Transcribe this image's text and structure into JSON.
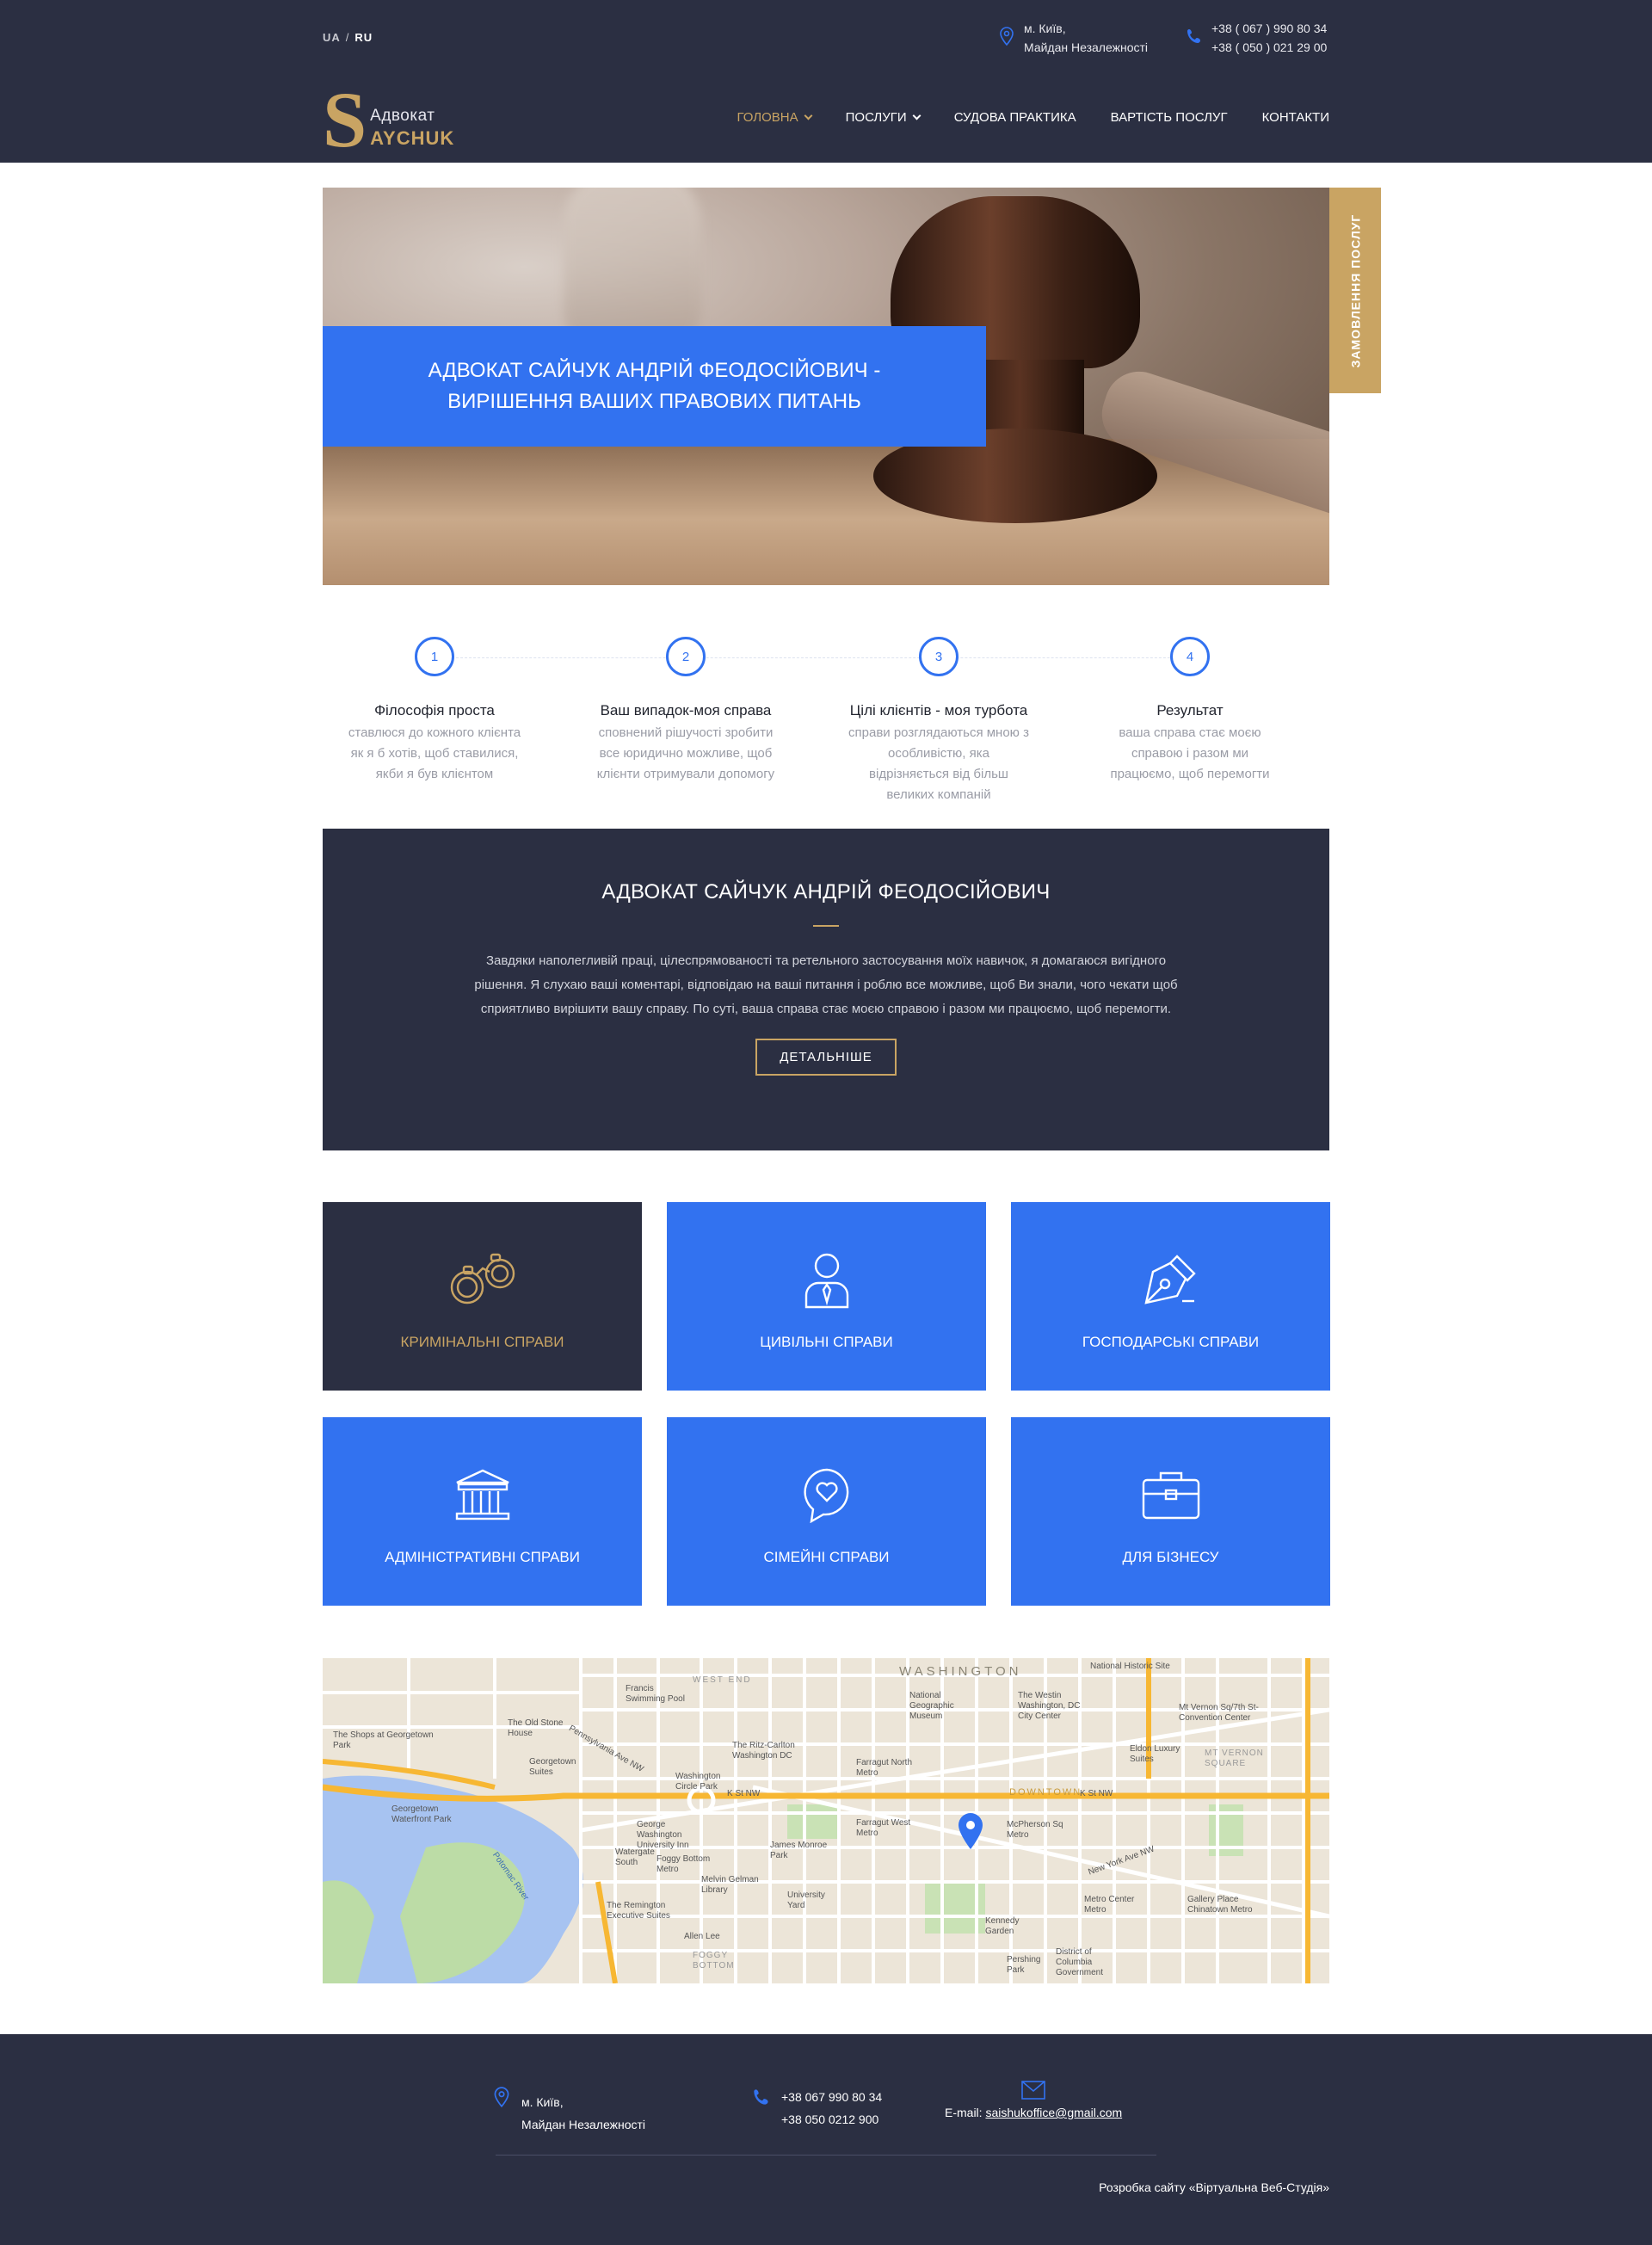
{
  "header": {
    "lang": {
      "ua": "UA",
      "sep": "/",
      "ru": "RU"
    },
    "address": {
      "line1": "м. Київ,",
      "line2": "Майдан Незалежності"
    },
    "phones": {
      "line1": "+38 ( 067 ) 990 80 34",
      "line2": "+38 ( 050 ) 021 29 00"
    },
    "logo": {
      "letter": "S",
      "line1": "Адвокат",
      "line2": "AYCHUK"
    },
    "nav": [
      "ГОЛОВНА",
      "ПОСЛУГИ",
      "СУДОВА ПРАКТИКА",
      "ВАРТІСТЬ ПОСЛУГ",
      "КОНТАКТИ"
    ]
  },
  "hero": {
    "title": "АДВОКАТ САЙЧУК АНДРІЙ ФЕОДОСІЙОВИЧ - ВИРІШЕННЯ ВАШИХ ПРАВОВИХ ПИТАНЬ",
    "order_tab": "ЗАМОВЛЕННЯ ПОСЛУГ"
  },
  "steps": [
    {
      "num": "1",
      "title": "Філософія проста",
      "desc": "ставлюся до кожного клієнта як я б хотів, щоб ставилися, якби я був клієнтом"
    },
    {
      "num": "2",
      "title": "Ваш випадок-моя справа",
      "desc": "сповнений рішучості зробити все юридично можливе, щоб клієнти отримували допомогу"
    },
    {
      "num": "3",
      "title": "Цілі клієнтів - моя турбота",
      "desc": "справи розглядаються мною з особливістю, яка відрізняється від більш великих компаній"
    },
    {
      "num": "4",
      "title": "Результат",
      "desc": "ваша справа стає моєю справою  і разом ми працюємо, щоб перемогти"
    }
  ],
  "about": {
    "title": "АДВОКАТ САЙЧУК АНДРІЙ ФЕОДОСІЙОВИЧ",
    "text": "Завдяки наполегливій праці, цілеспрямованості та ретельного застосування моїх навичок, я домагаюся вигідного рішення. Я слухаю ваші коментарі, відповідаю на ваші питання і роблю все можливе, щоб Ви знали, чого чекати щоб сприятливо вирішити вашу справу. По суті, ваша справа стає моєю справою  і разом ми працюємо, щоб перемогти.",
    "button": "ДЕТАЛЬНІШЕ"
  },
  "services": [
    {
      "label": "КРИМІНАЛЬНІ СПРАВИ",
      "icon": "handcuffs-icon"
    },
    {
      "label": "ЦИВІЛЬНІ СПРАВИ",
      "icon": "person-icon"
    },
    {
      "label": "ГОСПОДАРСЬКІ СПРАВИ",
      "icon": "pen-nib-icon"
    },
    {
      "label": "АДМІНІСТРАТИВНІ СПРАВИ",
      "icon": "courthouse-icon"
    },
    {
      "label": "СІМЕЙНІ СПРАВИ",
      "icon": "heart-chat-icon"
    },
    {
      "label": "ДЛЯ БІЗНЕСУ",
      "icon": "briefcase-icon"
    }
  ],
  "map": {
    "labels": {
      "washington": "WASHINGTON",
      "downtown": "DOWNTOWN",
      "kst": "K St NW",
      "kst2": "K St NW",
      "nyave": "New York Ave NW",
      "penn": "Pennsylvania Ave NW",
      "potomac": "Potomac River",
      "georgetown_park": "The Shops at Georgetown Park",
      "waterfront": "Georgetown Waterfront Park",
      "farragut_n": "Farragut North Metro",
      "farragut_w": "Farragut West Metro",
      "mcpherson": "McPherson Sq Metro",
      "metro_center": "Metro Center Metro",
      "national_geo": "National Geographic Museum",
      "westin": "The Westin Washington, DC City Center",
      "mt_vernon": "Mt Vernon Sq/7th St-Convention Center",
      "gwu": "George Washington University Inn",
      "foggy": "Foggy Bottom Metro",
      "kennedy": "Kennedy Garden",
      "chinatown": "Gallery Place Chinatown Metro",
      "ritz": "The Ritz-Carlton Washington DC",
      "circle": "Washington Circle Park",
      "franklin": "Francis Swimming Pool",
      "old_stone": "The Old Stone House",
      "pershing": "Pershing Park",
      "district": "District of Columbia Government",
      "remington": "The Remington Executive Suites",
      "watergate": "Watergate South",
      "university_yard": "University Yard",
      "melvin": "Melvin Gelman Library",
      "james_monroe": "James Monroe Park",
      "eldon": "Eldon Luxury Suites",
      "natl_hist": "National Historic Site",
      "mt_vernon_sq": "MT VERNON SQUARE",
      "foggy_bottom": "FOGGY BOTTOM",
      "allen": "Allen Lee",
      "georgetown_suites": "Georgetown Suites",
      "west_end": "WEST END"
    }
  },
  "footer": {
    "address": {
      "line1": "м. Київ,",
      "line2": "Майдан Незалежності"
    },
    "phones": {
      "line1": "+38 067 990 80 34",
      "line2": "+38 050 0212 900"
    },
    "email_label": "E-mail:",
    "email": "saishukoffice@gmail.com",
    "developer": "Розробка сайту «Віртуальна Веб-Студія»"
  },
  "colors": {
    "navy": "#2b2f42",
    "blue": "#3272f0",
    "gold": "#c9a463"
  }
}
